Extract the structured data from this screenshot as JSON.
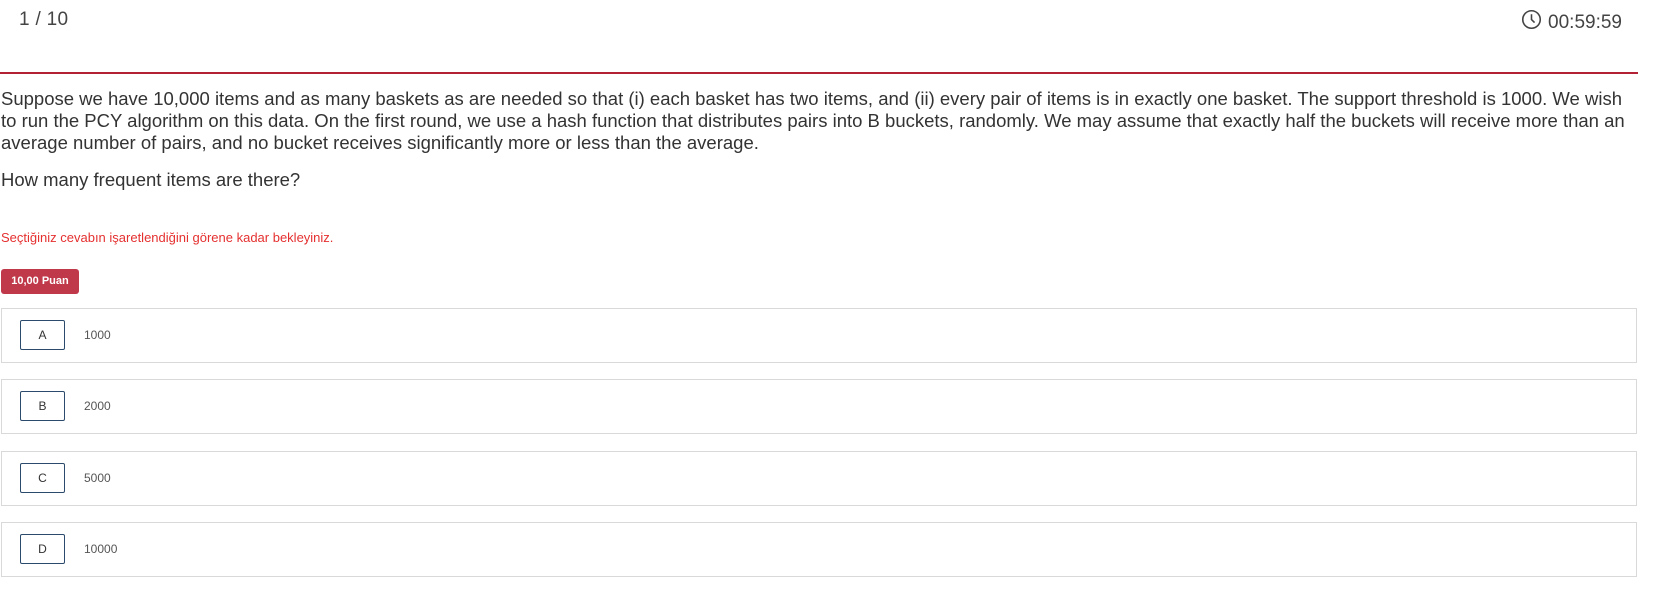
{
  "header": {
    "counter": "1 / 10",
    "timer": "00:59:59",
    "timer_icon": "clock-icon",
    "accent_color": "#b22234"
  },
  "question": {
    "text": "Suppose we have 10,000 items and as many baskets as are needed so that (i) each basket has two items, and (ii) every pair of items is in exactly one basket. The support threshold is 1000. We wish to run the PCY algorithm on this data. On the first round, we use a hash function that distributes pairs into B buckets, randomly. We may assume that exactly half the buckets will receive more than an average number of pairs, and no bucket receives significantly more or less than the average.",
    "prompt": "How many frequent items are there?"
  },
  "warning": {
    "text": "Seçtiğiniz cevabın işaretlendiğini görene kadar bekleyiniz.",
    "color": "#e53030"
  },
  "points": {
    "label": "10,00 Puan",
    "color": "#c0394b"
  },
  "options": [
    {
      "letter": "A",
      "value": "1000"
    },
    {
      "letter": "B",
      "value": "2000"
    },
    {
      "letter": "C",
      "value": "5000"
    },
    {
      "letter": "D",
      "value": "10000"
    }
  ]
}
